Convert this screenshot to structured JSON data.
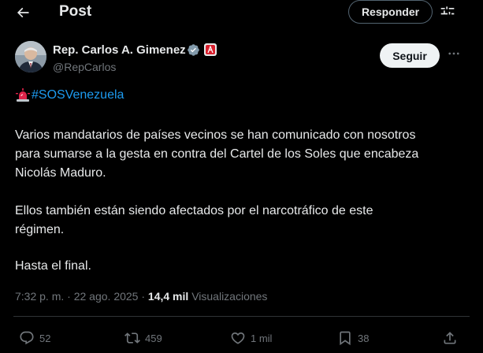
{
  "header": {
    "title": "Post",
    "reply_label": "Responder"
  },
  "author": {
    "name": "Rep. Carlos A. Gimenez",
    "handle": "@RepCarlos",
    "follow_label": "Seguir"
  },
  "post": {
    "hashtag": "#SOSVenezuela",
    "paragraph1_line1": "Varios mandatarios de países vecinos se han comunicado con nosotros",
    "paragraph1_line2": "para sumarse a la gesta en contra del Cartel de los Soles que encabeza",
    "paragraph1_line3": "Nicolás Maduro.",
    "paragraph2_line1": "Ellos también están siendo afectados por el narcotráfico de este",
    "paragraph2_line2": "régimen.",
    "paragraph3": "Hasta el final."
  },
  "meta": {
    "time": "7:32 p. m.",
    "separator": " · ",
    "date": "22 ago. 2025",
    "views_count": "14,4 mil",
    "views_label": "Visualizaciones"
  },
  "actions": {
    "replies": "52",
    "reposts": "459",
    "likes": "1 mil",
    "bookmarks": "38"
  },
  "colors": {
    "background": "#000000",
    "text": "#e7e9ea",
    "secondary": "#71767b",
    "link": "#1d9bf0",
    "verified": "#829aab",
    "flag_red": "#d81e2c"
  },
  "icons": [
    "back-arrow-icon",
    "filter-icon",
    "verified-icon",
    "flag-icon",
    "more-icon",
    "siren-icon",
    "reply-icon",
    "repost-icon",
    "like-icon",
    "bookmark-icon",
    "share-icon"
  ]
}
